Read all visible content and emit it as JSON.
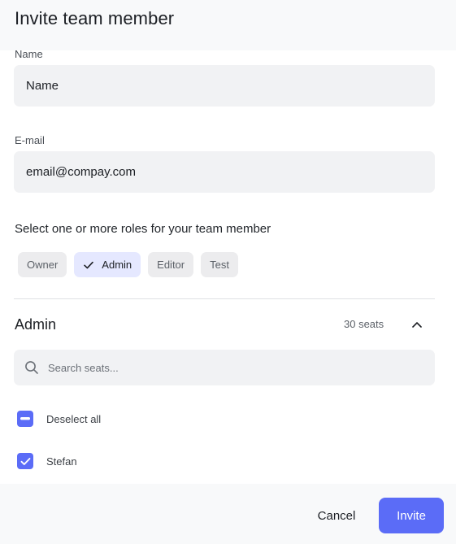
{
  "dialog": {
    "title": "Invite team member"
  },
  "form": {
    "name": {
      "label": "Name",
      "value": "Name"
    },
    "email": {
      "label": "E-mail",
      "value": "email@compay.com"
    },
    "roles_prompt": "Select one or more roles for your team member",
    "roles": [
      {
        "label": "Owner",
        "selected": false
      },
      {
        "label": "Admin",
        "selected": true
      },
      {
        "label": "Editor",
        "selected": false
      },
      {
        "label": "Test",
        "selected": false
      }
    ]
  },
  "seats_section": {
    "title": "Admin",
    "seats_count": "30 seats",
    "expanded": true,
    "search_placeholder": "Search seats...",
    "deselect_all_label": "Deselect all",
    "members": [
      {
        "name": "Stefan",
        "checked": true
      }
    ]
  },
  "footer": {
    "cancel_label": "Cancel",
    "invite_label": "Invite"
  },
  "colors": {
    "accent": "#5b6cf7",
    "selected_chip_bg": "#e5e8ff",
    "field_bg": "#f1f2f4",
    "header_footer_bg": "#f8f9fa"
  },
  "icons": {
    "check": "check-icon",
    "collapse": "chevron-up-icon",
    "search": "search-icon",
    "deselect": "minus-icon"
  }
}
